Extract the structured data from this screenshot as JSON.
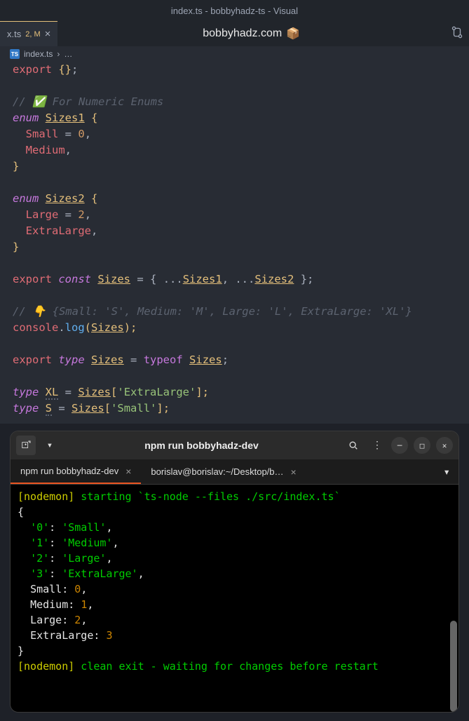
{
  "window": {
    "title": "index.ts - bobbyhadz-ts - Visual"
  },
  "tab": {
    "name": "x.ts",
    "status": "2, M"
  },
  "headerSite": "bobbyhadz.com",
  "headerEmoji": "📦",
  "breadcrumb": {
    "file": "index.ts",
    "sep": "›",
    "more": "…"
  },
  "code": {
    "l1": {
      "export": "export",
      "braces": "{}",
      "semi": ";"
    },
    "l2": {
      "comment": "// ✅ For Numeric Enums"
    },
    "l3": {
      "enum": "enum",
      "name": "Sizes1",
      "open": "{"
    },
    "l4": {
      "member": "Small",
      "eq": " = ",
      "val": "0",
      "comma": ","
    },
    "l5": {
      "member": "Medium",
      "comma": ","
    },
    "l6": {
      "close": "}"
    },
    "l7": {
      "enum": "enum",
      "name": "Sizes2",
      "open": "{"
    },
    "l8": {
      "member": "Large",
      "eq": " = ",
      "val": "2",
      "comma": ","
    },
    "l9": {
      "member": "ExtraLarge",
      "comma": ","
    },
    "l10": {
      "close": "}"
    },
    "l11": {
      "export": "export",
      "const": "const",
      "name": "Sizes",
      "eq": " = { ...",
      "s1": "Sizes1",
      "mid": ", ...",
      "s2": "Sizes2",
      "end": " };"
    },
    "l12": {
      "comment": "// 👇️ {Small: 'S', Medium: 'M', Large: 'L', ExtraLarge: 'XL'}"
    },
    "l13": {
      "obj": "console",
      "dot": ".",
      "fn": "log",
      "open": "(",
      "arg": "Sizes",
      "close": ");"
    },
    "l14": {
      "export": "export",
      "type": "type",
      "name": "Sizes",
      "eq": " = ",
      "typeof": "typeof",
      "ref": "Sizes",
      "semi": ";"
    },
    "l15": {
      "type": "type",
      "name": "XL",
      "eq": " = ",
      "ref": "Sizes",
      "idx": "[",
      "str": "'ExtraLarge'",
      "end": "];"
    },
    "l16": {
      "type": "type",
      "name": "S",
      "eq": " = ",
      "ref": "Sizes",
      "idx": "[",
      "str": "'Small'",
      "end": "];"
    }
  },
  "terminal": {
    "title": "npm run bobbyhadz-dev",
    "tabs": [
      {
        "label": "npm run bobbyhadz-dev",
        "active": true
      },
      {
        "label": "borislav@borislav:~/Desktop/b…",
        "active": false
      }
    ],
    "lines": {
      "start": {
        "prefix": "[nodemon]",
        "text": " starting `",
        "cmd": "ts-node --files ./src/index.ts",
        "tick": "`"
      },
      "open": "{",
      "r0": {
        "k": "'0'",
        "c": ": ",
        "v": "'Small'",
        "comma": ","
      },
      "r1": {
        "k": "'1'",
        "c": ": ",
        "v": "'Medium'",
        "comma": ","
      },
      "r2": {
        "k": "'2'",
        "c": ": ",
        "v": "'Large'",
        "comma": ","
      },
      "r3": {
        "k": "'3'",
        "c": ": ",
        "v": "'ExtraLarge'",
        "comma": ","
      },
      "r4": {
        "k": "Small:",
        "v": "0",
        "comma": ","
      },
      "r5": {
        "k": "Medium:",
        "v": "1",
        "comma": ","
      },
      "r6": {
        "k": "Large:",
        "v": "2",
        "comma": ","
      },
      "r7": {
        "k": "ExtraLarge:",
        "v": "3"
      },
      "close": "}",
      "exit": {
        "prefix": "[nodemon]",
        "text": " clean exit - waiting for changes before restart"
      }
    }
  }
}
